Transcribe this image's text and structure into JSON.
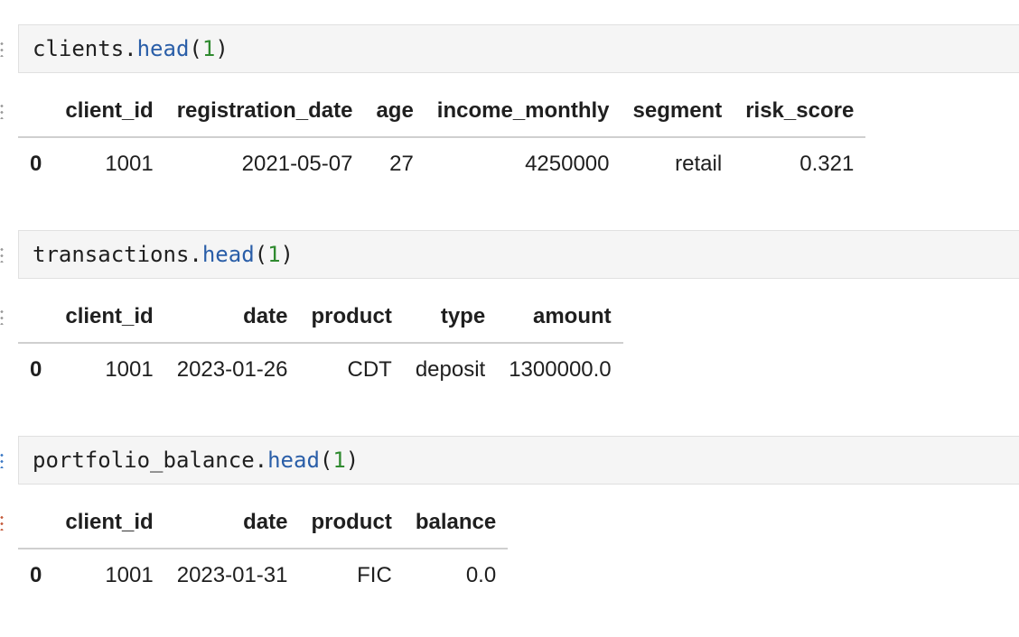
{
  "cells": [
    {
      "code": {
        "object": "clients",
        "method": "head",
        "arg": "1"
      },
      "columns": [
        "client_id",
        "registration_date",
        "age",
        "income_monthly",
        "segment",
        "risk_score"
      ],
      "rows": [
        {
          "index": "0",
          "values": [
            "1001",
            "2021-05-07",
            "27",
            "4250000",
            "retail",
            "0.321"
          ]
        }
      ]
    },
    {
      "code": {
        "object": "transactions",
        "method": "head",
        "arg": "1"
      },
      "columns": [
        "client_id",
        "date",
        "product",
        "type",
        "amount"
      ],
      "rows": [
        {
          "index": "0",
          "values": [
            "1001",
            "2023-01-26",
            "CDT",
            "deposit",
            "1300000.0"
          ]
        }
      ]
    },
    {
      "code": {
        "object": "portfolio_balance",
        "method": "head",
        "arg": "1"
      },
      "columns": [
        "client_id",
        "date",
        "product",
        "balance"
      ],
      "rows": [
        {
          "index": "0",
          "values": [
            "1001",
            "2023-01-31",
            "FIC",
            "0.0"
          ]
        }
      ]
    }
  ]
}
